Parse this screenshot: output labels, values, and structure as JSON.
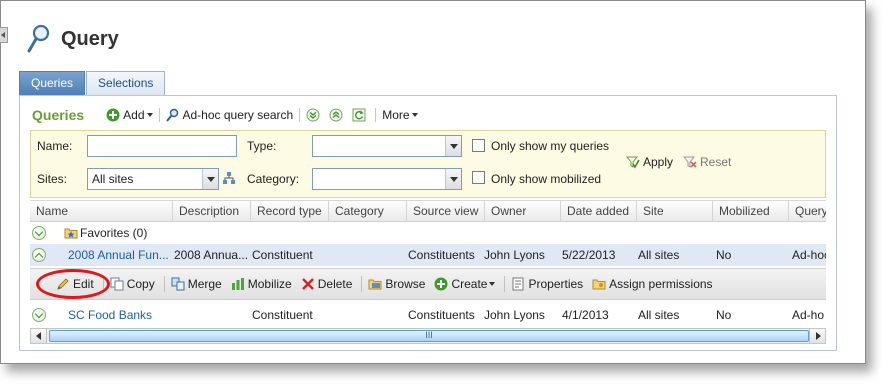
{
  "page": {
    "title": "Query"
  },
  "tabs": [
    {
      "label": "Queries"
    },
    {
      "label": "Selections"
    }
  ],
  "toolbar": {
    "section_title": "Queries",
    "add_label": "Add",
    "adhoc_label": "Ad-hoc query search",
    "more_label": "More"
  },
  "filters": {
    "name_label": "Name:",
    "name_value": "",
    "type_label": "Type:",
    "type_value": "",
    "only_mine_label": "Only show my queries",
    "sites_label": "Sites:",
    "sites_value": "All sites",
    "category_label": "Category:",
    "category_value": "",
    "only_mobilized_label": "Only show mobilized",
    "apply_label": "Apply",
    "reset_label": "Reset"
  },
  "grid": {
    "columns": [
      "Name",
      "Description",
      "Record type",
      "Category",
      "Source view",
      "Owner",
      "Date added",
      "Site",
      "Mobilized",
      "Query"
    ],
    "favorites_label": "Favorites (0)",
    "rows": [
      {
        "name": "2008 Annual Fun...",
        "description": "2008 Annua...",
        "record_type": "Constituent",
        "category": "",
        "source_view": "Constituents",
        "owner": "John Lyons",
        "date_added": "5/22/2013",
        "site": "All sites",
        "mobilized": "No",
        "query": "Ad-hoc"
      },
      {
        "name": "SC Food Banks",
        "description": "",
        "record_type": "Constituent",
        "category": "",
        "source_view": "Constituents",
        "owner": "John Lyons",
        "date_added": "4/1/2013",
        "site": "All sites",
        "mobilized": "No",
        "query": "Ad-ho"
      }
    ],
    "actions": {
      "edit": "Edit",
      "copy": "Copy",
      "merge": "Merge",
      "mobilize": "Mobilize",
      "delete": "Delete",
      "browse": "Browse",
      "create": "Create",
      "properties": "Properties",
      "assign_permissions": "Assign permissions"
    },
    "scroll_grip": "III"
  },
  "colors": {
    "accent": "#4f7fb6",
    "section_green": "#6a9c35",
    "link": "#1f5fa0",
    "filter_bg": "#fdfbe3",
    "highlight_red": "#e0161b",
    "selected_row": "#dfe8f4"
  },
  "icons": [
    "magnifier-icon",
    "add-icon",
    "adhoc-search-icon",
    "expand-all-icon",
    "collapse-all-icon",
    "refresh-icon",
    "apply-icon",
    "reset-icon",
    "sites-tree-icon",
    "star-folder-icon",
    "edit-icon",
    "copy-icon",
    "merge-icon",
    "mobilize-icon",
    "delete-icon",
    "browse-icon",
    "create-icon",
    "properties-icon",
    "permissions-icon"
  ]
}
